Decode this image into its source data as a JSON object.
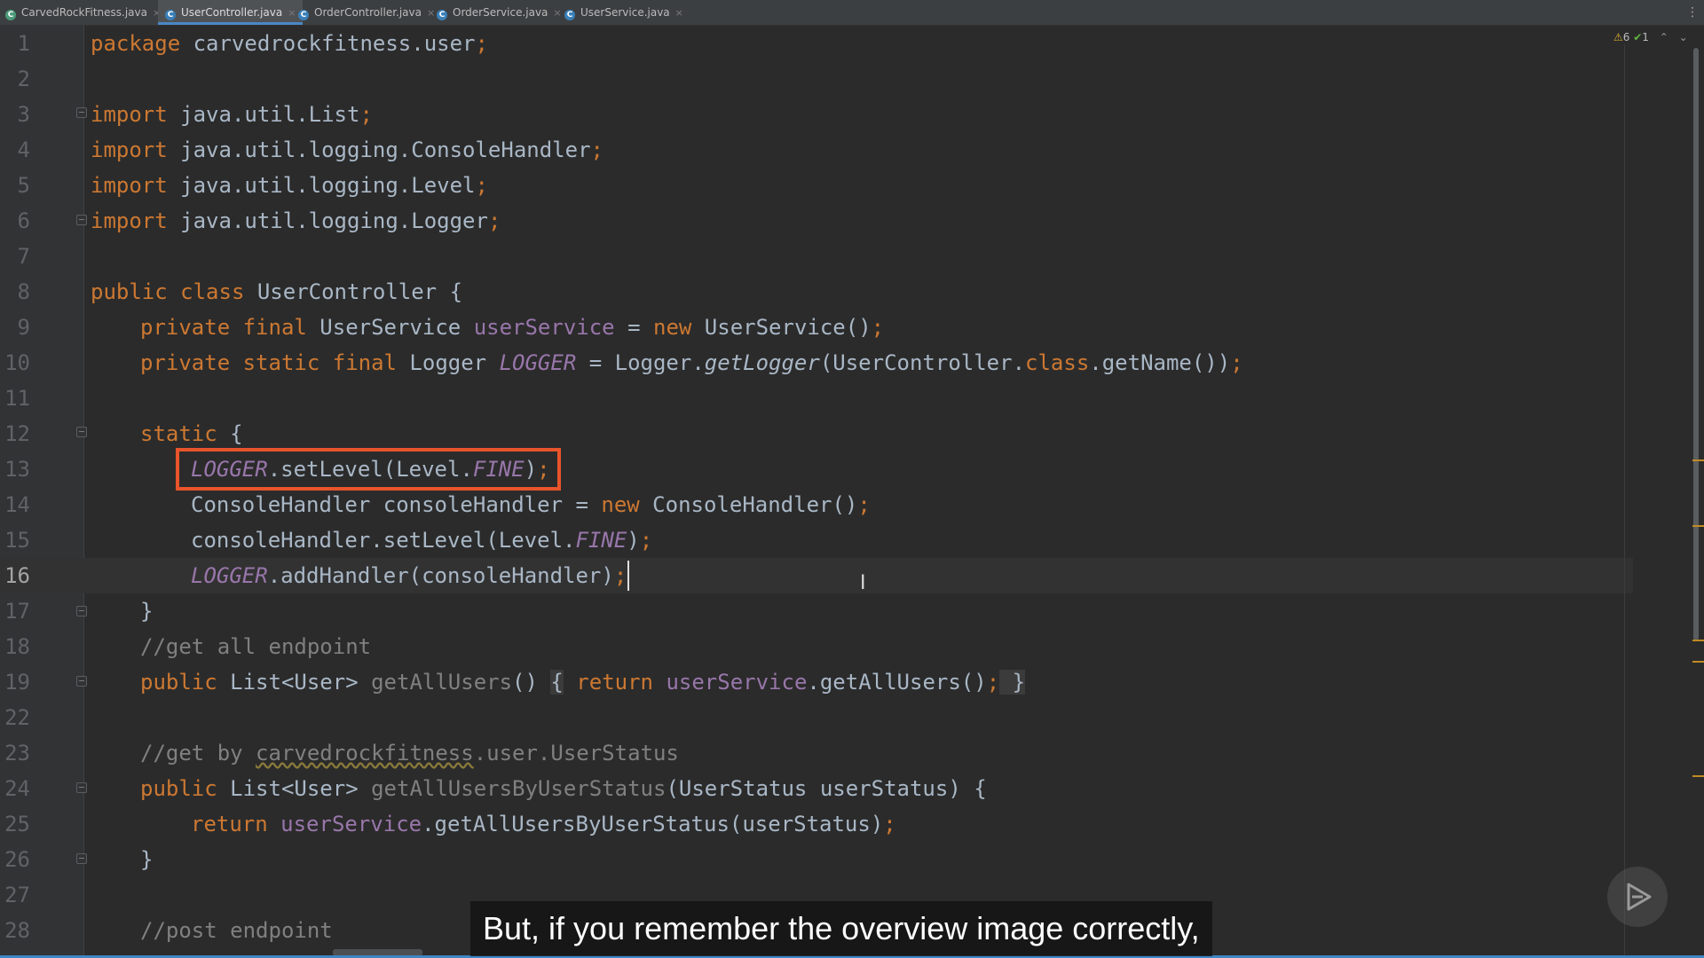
{
  "tabs": [
    {
      "label": "CarvedRockFitness.java",
      "icon": "java-main-class-icon",
      "active": false
    },
    {
      "label": "UserController.java",
      "icon": "java-class-icon",
      "active": true
    },
    {
      "label": "OrderController.java",
      "icon": "java-class-icon",
      "active": false
    },
    {
      "label": "OrderService.java",
      "icon": "java-class-icon",
      "active": false
    },
    {
      "label": "UserService.java",
      "icon": "java-class-icon",
      "active": false
    }
  ],
  "tab_close_glyph": "×",
  "tab_icon_letter": "C",
  "tab_menu_glyph": "⋮",
  "inspections": {
    "warnings": "6",
    "ok": "1",
    "warning_glyph": "⚠",
    "ok_glyph": "✔",
    "nav_up": "⌃",
    "nav_down": "⌄"
  },
  "editor": {
    "current_line": "16",
    "highlighted_line": "13",
    "line_numbers": [
      "1",
      "2",
      "3",
      "4",
      "5",
      "6",
      "7",
      "8",
      "9",
      "10",
      "11",
      "12",
      "13",
      "14",
      "15",
      "16",
      "17",
      "18",
      "19",
      "22",
      "23",
      "24",
      "25",
      "26",
      "27",
      "28"
    ],
    "code": {
      "l1": {
        "kw": "package",
        "rest": " carvedrockfitness.user",
        "semi": ";"
      },
      "l3": {
        "kw": "import",
        "rest": " java.util.List",
        "semi": ";"
      },
      "l4": {
        "kw": "import",
        "rest": " java.util.logging.ConsoleHandler",
        "semi": ";"
      },
      "l5": {
        "kw": "import",
        "rest": " java.util.logging.Level",
        "semi": ";"
      },
      "l6": {
        "kw": "import",
        "rest": " java.util.logging.Logger",
        "semi": ";"
      },
      "l8": {
        "kw": "public class",
        "rest": " UserController {"
      },
      "l9": {
        "kw1": "private final",
        "t1": " UserService ",
        "field": "userService",
        "t2": " = ",
        "kw2": "new",
        "t3": " UserService()",
        "semi": ";"
      },
      "l10": {
        "kw1": "private static final",
        "t1": " Logger ",
        "const": "LOGGER",
        "t2": " = Logger.",
        "meth": "getLogger",
        "t3": "(UserController.",
        "kw2": "class",
        "t4": ".getName())",
        "semi": ";"
      },
      "l12": {
        "kw": "static",
        "rest": " {"
      },
      "l13": {
        "const": "LOGGER",
        "t1": ".setLevel(Level.",
        "const2": "FINE",
        "t2": ")",
        "semi": ";"
      },
      "l14": {
        "t1": "ConsoleHandler consoleHandler = ",
        "kw": "new",
        "t2": " ConsoleHandler()",
        "semi": ";"
      },
      "l15": {
        "t1": "consoleHandler.setLevel(Level.",
        "const": "FINE",
        "t2": ")",
        "semi": ";"
      },
      "l16": {
        "const": "LOGGER",
        "t1": ".addHandler(consoleHandler)",
        "semi": ";"
      },
      "l17": {
        "rest": "}"
      },
      "l18": {
        "comment": "//get all endpoint"
      },
      "l19": {
        "kw": "public",
        "t1": " List<User> ",
        "dim": "getAllUsers",
        "t2": "() ",
        "b1": "{",
        "kw2": " return ",
        "field": "userService",
        "t3": ".getAllUsers()",
        "semi": ";",
        "b2": " }"
      },
      "l23": {
        "comment1": "//get by ",
        "typo": "carvedrockfitness",
        "comment2": ".user.UserStatus"
      },
      "l24": {
        "kw": "public",
        "t1": " List<User> ",
        "dim": "getAllUsersByUserStatus",
        "t2": "(UserStatus userStatus) {"
      },
      "l25": {
        "kw": "return",
        "t0": " ",
        "field": "userService",
        "t1": ".getAllUsersByUserStatus(userStatus)",
        "semi": ";"
      },
      "l26": {
        "rest": "}"
      },
      "l28": {
        "comment": "//post endpoint"
      }
    }
  },
  "ibeam_glyph": "I",
  "subtitle": "But, if you remember the overview image correctly,",
  "colors": {
    "accent": "#3e86c5",
    "highlight_box": "#e8542b",
    "keyword": "#cc7832",
    "field": "#9876aa",
    "comment": "#808080",
    "background": "#2b2b2b"
  }
}
